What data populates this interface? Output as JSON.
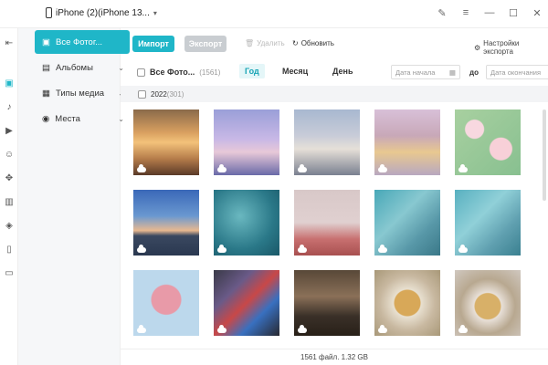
{
  "window": {
    "device_name": "iPhone (2)(iPhone 13..."
  },
  "sidebar": {
    "items": [
      {
        "label": "Все Фотог...",
        "icon": "photo-icon"
      },
      {
        "label": "Альбомы",
        "icon": "album-icon"
      },
      {
        "label": "Типы медиа",
        "icon": "media-types-icon"
      },
      {
        "label": "Места",
        "icon": "location-icon"
      }
    ]
  },
  "toolbar": {
    "import_label": "Импорт",
    "export_label": "Экспорт",
    "delete_label": "Удалить",
    "refresh_label": "Обновить",
    "settings_label": "Настройки экспорта"
  },
  "filter": {
    "all_label": "Все Фото...",
    "count": "(1561)",
    "year": "Год",
    "month": "Месяц",
    "day": "День",
    "start_date_placeholder": "Дата начала",
    "to_label": "до",
    "end_date_placeholder": "Дата окончания"
  },
  "group": {
    "label": "2022",
    "count": "(301)"
  },
  "status": {
    "text": "1561 файл. 1.32 GB"
  },
  "colors": {
    "accent": "#1fb6c8"
  }
}
